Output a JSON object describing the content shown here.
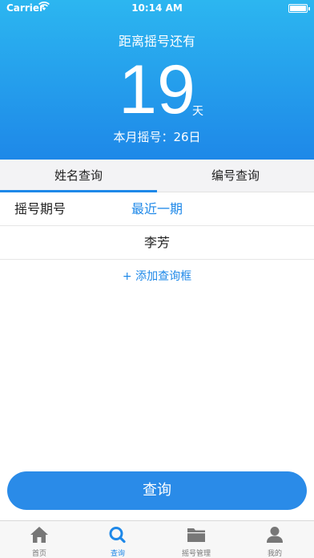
{
  "status_bar": {
    "carrier": "Carrier",
    "time": "10:14 AM"
  },
  "hero": {
    "countdown_label": "距离摇号还有",
    "countdown_days": "19",
    "countdown_unit": "天",
    "monthly_text": "本月摇号：26日"
  },
  "tabs": [
    {
      "label": "姓名查询",
      "active": true
    },
    {
      "label": "编号查询",
      "active": false
    }
  ],
  "form": {
    "period_label": "摇号期号",
    "period_value": "最近一期",
    "name_value": "李芳",
    "add_box_label": "+ 添加查询框"
  },
  "query_button": {
    "label": "查询"
  },
  "tabbar": [
    {
      "label": "首页",
      "icon": "home-icon",
      "active": false
    },
    {
      "label": "查询",
      "icon": "search-icon",
      "active": true
    },
    {
      "label": "摇号管理",
      "icon": "folder-icon",
      "active": false
    },
    {
      "label": "我的",
      "icon": "user-icon",
      "active": false
    }
  ],
  "colors": {
    "accent": "#1e88e8",
    "hero_top": "#2cb6f0",
    "hero_bottom": "#1e88e8",
    "tabbar_inactive": "#777777"
  }
}
